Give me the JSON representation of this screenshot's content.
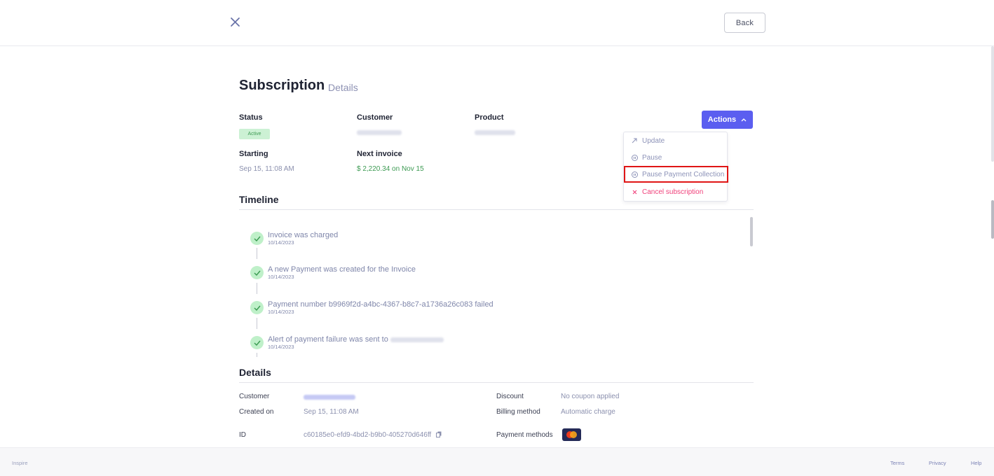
{
  "header": {
    "close_icon": "close-icon",
    "back_label": "Back"
  },
  "page": {
    "title": "Subscription",
    "subtitle": "Details"
  },
  "summary": {
    "status_label": "Status",
    "status_value": "Active",
    "customer_label": "Customer",
    "product_label": "Product",
    "starting_label": "Starting",
    "starting_value": "Sep 15, 11:08 AM",
    "next_invoice_label": "Next invoice",
    "next_invoice_value": "$ 2,220.34 on Nov 15"
  },
  "actions": {
    "button_label": "Actions",
    "items": [
      {
        "label": "Update",
        "icon": "arrow-up-right-icon"
      },
      {
        "label": "Pause",
        "icon": "pause-circle-icon"
      },
      {
        "label": "Pause Payment Collection",
        "icon": "pause-circle-icon"
      },
      {
        "label": "Cancel subscription",
        "icon": "x-icon"
      }
    ]
  },
  "timeline": {
    "title": "Timeline",
    "events": [
      {
        "title": "Invoice was charged",
        "date": "10/14/2023"
      },
      {
        "title": "A new Payment was created for the Invoice",
        "date": "10/14/2023"
      },
      {
        "title": "Payment number b9969f2d-a4bc-4367-b8c7-a1736a26c083 failed",
        "date": "10/14/2023"
      },
      {
        "title": "Alert of payment failure was sent to",
        "date": "10/14/2023"
      }
    ]
  },
  "details": {
    "title": "Details",
    "customer_label": "Customer",
    "created_label": "Created on",
    "created_value": "Sep 15, 11:08 AM",
    "id_label": "ID",
    "id_value": "c60185e0-efd9-4bd2-b9b0-405270d646ff",
    "discount_label": "Discount",
    "discount_value": "No coupon applied",
    "billing_label": "Billing method",
    "billing_value": "Automatic charge",
    "payment_methods_label": "Payment methods"
  },
  "footer": {
    "brand": "Inspire",
    "links": [
      "Terms",
      "Privacy",
      "Help"
    ]
  },
  "colors": {
    "accent": "#5b5ef0",
    "active_badge_bg": "#ccf1d4",
    "success": "#3c9a52",
    "danger": "#f0407a",
    "highlight": "#e01515"
  }
}
